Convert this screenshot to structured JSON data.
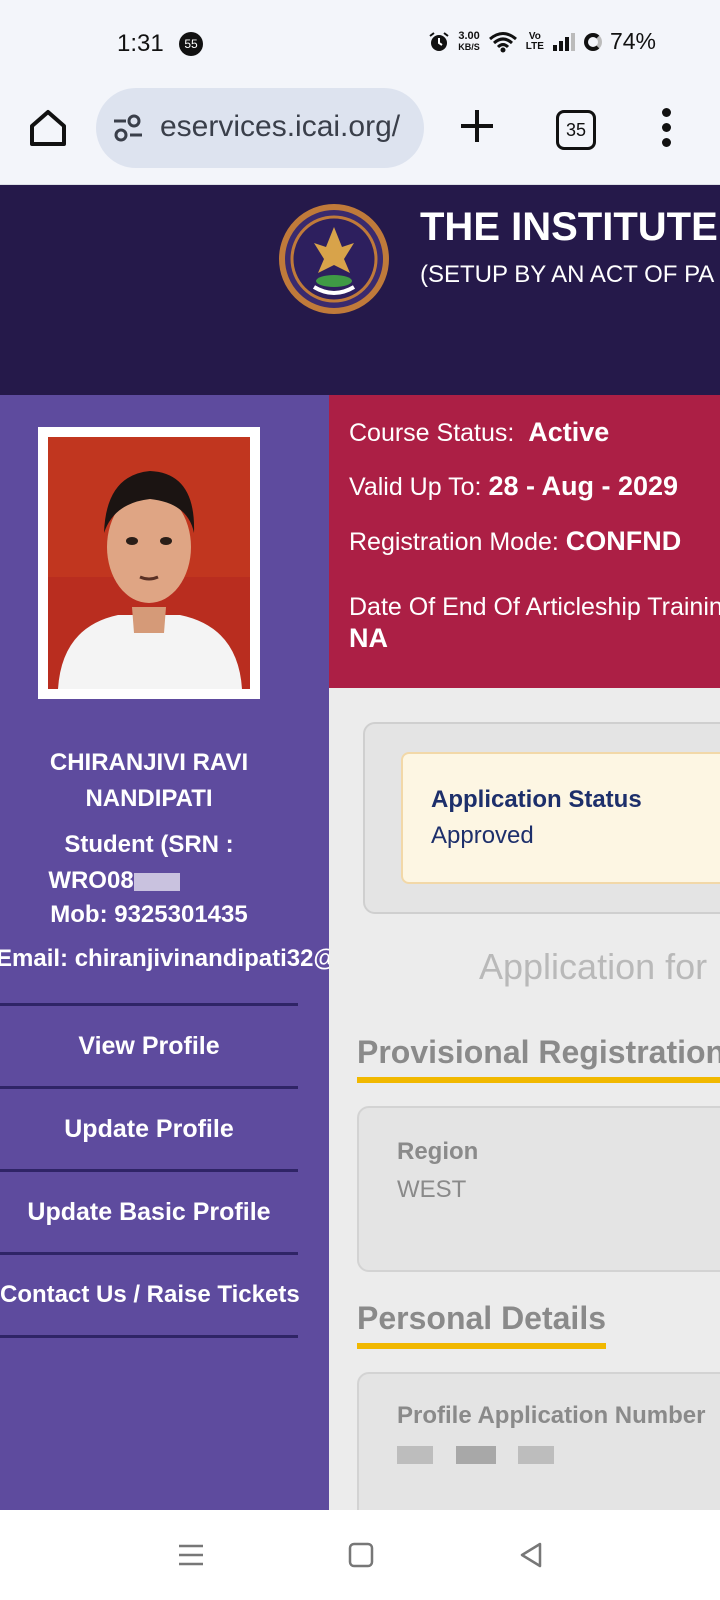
{
  "status_bar": {
    "time": "1:31",
    "notification_count": "55",
    "net_speed_value": "3.00",
    "net_speed_unit": "KB/S",
    "volte_top": "Vo",
    "volte_bottom": "LTE",
    "battery": "74%"
  },
  "browser": {
    "url": "eservices.icai.org/",
    "tab_count": "35"
  },
  "header": {
    "title": "THE INSTITUTE",
    "subtitle": "(SETUP BY AN ACT OF PA"
  },
  "profile": {
    "name_line1": "CHIRANJIVI RAVI",
    "name_line2": "NANDIPATI",
    "student_line1": "Student (SRN :",
    "student_line2": "WRO08",
    "mobile": "Mob: 9325301435",
    "email": "Email: chiranjivinandipati32@"
  },
  "sidebar": {
    "items": [
      {
        "label": "View Profile"
      },
      {
        "label": "Update Profile"
      },
      {
        "label": "Update Basic Profile"
      },
      {
        "label": "Contact Us / Raise Tickets"
      }
    ]
  },
  "course": {
    "status_label": "Course Status:",
    "status_value": "Active",
    "valid_label": "Valid Up To:",
    "valid_value": "28 - Aug - 2029",
    "mode_label": "Registration Mode:",
    "mode_value": "CONFND",
    "articleship_label": "Date Of End Of Articleship Trainin",
    "articleship_value": "NA"
  },
  "application": {
    "status_label": "Application Status",
    "status_value": "Approved",
    "heading": "Application for P"
  },
  "sections": {
    "provisional_title": "Provisional Registration",
    "region_label": "Region",
    "region_value": "WEST",
    "personal_title": "Personal Details",
    "app_number_label": "Profile Application Number"
  },
  "colors": {
    "header_bg": "#25194a",
    "sidebar_bg": "#5e4b9e",
    "course_card_bg": "#ac1f45",
    "section_underline": "#f1b800",
    "status_card_bg": "#fdf6e3"
  }
}
